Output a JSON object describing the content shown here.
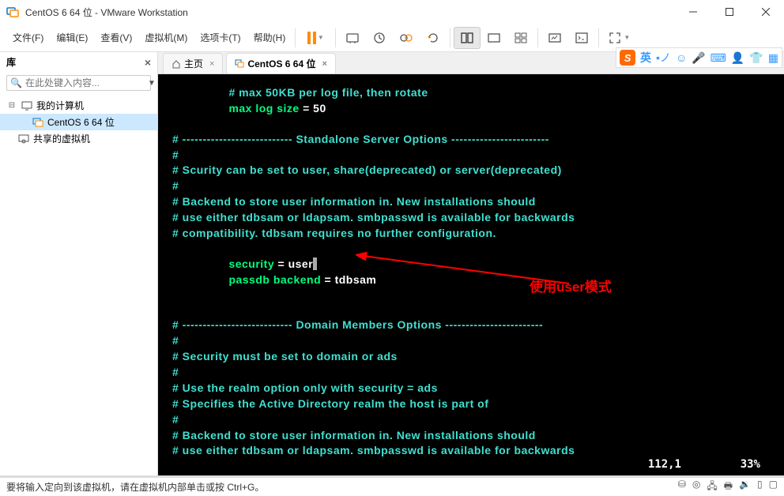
{
  "window": {
    "title": "CentOS 6 64 位 - VMware Workstation"
  },
  "menu": {
    "file": "文件(F)",
    "edit": "编辑(E)",
    "view": "查看(V)",
    "vm": "虚拟机(M)",
    "tabs": "选项卡(T)",
    "help": "帮助(H)"
  },
  "sidebar": {
    "title": "库",
    "search_placeholder": "在此处键入内容...",
    "items": {
      "root": "我的计算机",
      "vm1": "CentOS 6 64 位",
      "shared": "共享的虚拟机"
    }
  },
  "tabs": {
    "home": "主页",
    "vm": "CentOS 6 64 位"
  },
  "terminal": {
    "l1": "# max 50KB per log file, then rotate",
    "l2a": "max log size",
    "l2b": " = 50",
    "l3": "# --------------------------- Standalone Server Options ------------------------",
    "l4": "#",
    "l5": "# Scurity can be set to user, share(deprecated) or server(deprecated)",
    "l6": "#",
    "l7": "# Backend to store user information in. New installations should",
    "l8": "# use either tdbsam or ldapsam. smbpasswd is available for backwards",
    "l9": "# compatibility. tdbsam requires no further configuration.",
    "l10a": "security",
    "l10b": " = user",
    "l11a": "passdb backend",
    "l11b": " = tdbsam",
    "l12": "# --------------------------- Domain Members Options ------------------------",
    "l13": "#",
    "l14": "# Security must be set to domain or ads",
    "l15": "#",
    "l16": "# Use the realm option only with security = ads",
    "l17": "# Specifies the Active Directory realm the host is part of",
    "l18": "#",
    "l19": "# Backend to store user information in. New installations should",
    "l20": "# use either tdbsam or ldapsam. smbpasswd is available for backwards",
    "pos": "112,1",
    "pct": "33%"
  },
  "annotation": {
    "text": "使用user模式"
  },
  "ime": {
    "logo": "S",
    "lang": "英"
  },
  "statusbar": {
    "hint": "要将输入定向到该虚拟机，请在虚拟机内部单击或按 Ctrl+G。"
  }
}
